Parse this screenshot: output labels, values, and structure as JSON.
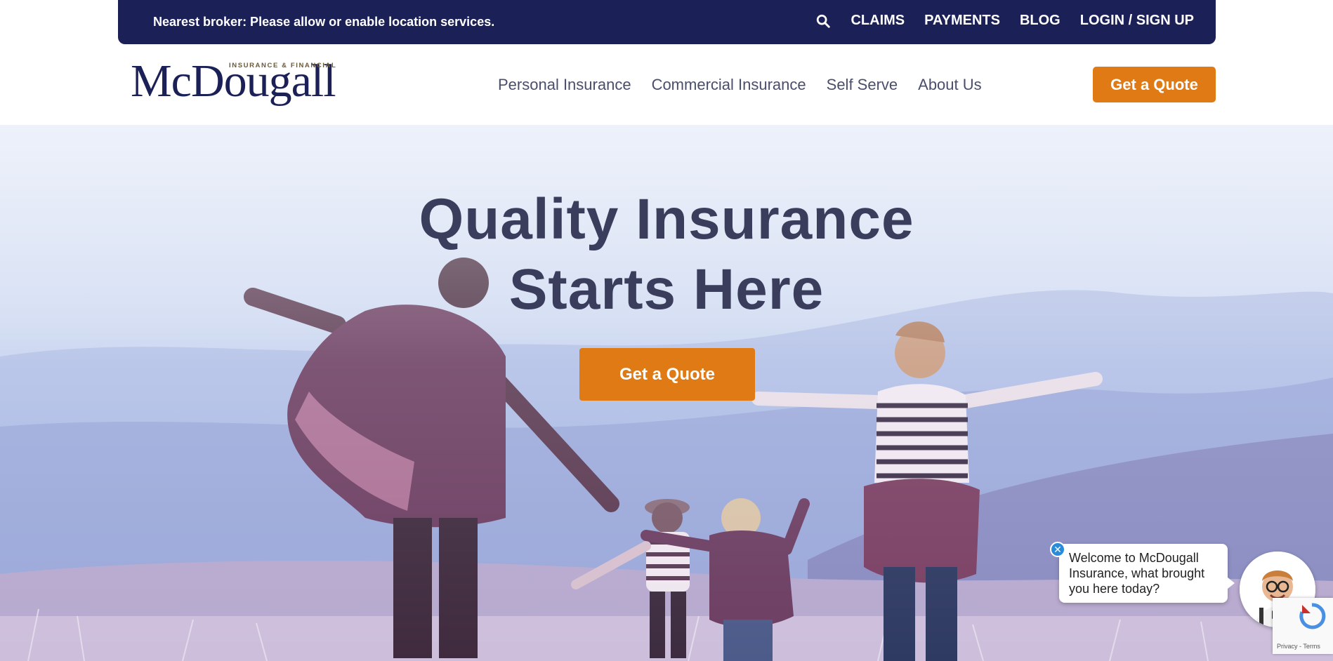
{
  "topbar": {
    "broker_text": "Nearest broker: Please allow or enable location services.",
    "links": [
      "CLAIMS",
      "PAYMENTS",
      "BLOG",
      "LOGIN / SIGN UP"
    ],
    "bg_color": "#1b2157"
  },
  "header": {
    "logo_wordmark": "McDougall",
    "logo_tagline": "INSURANCE & FINANCIAL",
    "nav": [
      "Personal Insurance",
      "Commercial Insurance",
      "Self Serve",
      "About Us"
    ],
    "quote_label": "Get a Quote"
  },
  "hero": {
    "headline_line1": "Quality Insurance",
    "headline_line2": "Starts Here",
    "cta_label": "Get a Quote"
  },
  "chat": {
    "message": "Welcome to McDougall Insurance, what brought you here today?",
    "close_icon": "close-icon"
  },
  "recaptcha": {
    "terms": "Privacy - Terms"
  },
  "colors": {
    "accent": "#e07a14",
    "navy": "#1b2157",
    "headline": "#3a3d5c"
  }
}
